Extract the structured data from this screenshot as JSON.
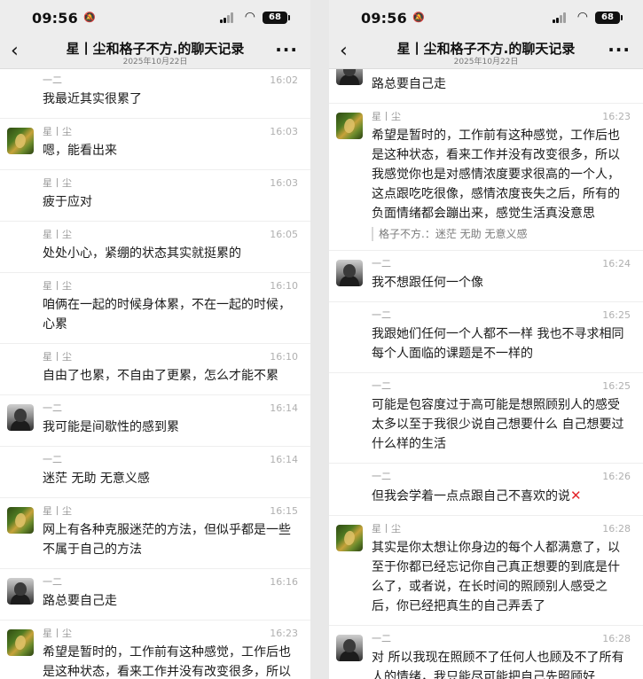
{
  "status": {
    "time": "09:56",
    "battery": "68"
  },
  "nav": {
    "back": "‹",
    "title": "星丨尘和格子不方.的聊天记录",
    "date": "2025年10月22日",
    "more": "···"
  },
  "left": {
    "messages": [
      {
        "sender": "一二",
        "time": "16:02",
        "text": "我最近其实很累了",
        "avatar": "one",
        "showAvatar": false
      },
      {
        "sender": "星丨尘",
        "time": "16:03",
        "text": "嗯，能看出来",
        "avatar": "star",
        "showAvatar": true
      },
      {
        "sender": "星丨尘",
        "time": "16:03",
        "text": "疲于应对",
        "avatar": "star",
        "showAvatar": false
      },
      {
        "sender": "星丨尘",
        "time": "16:05",
        "text": "处处小心，紧绷的状态其实就挺累的",
        "avatar": "star",
        "showAvatar": false
      },
      {
        "sender": "星丨尘",
        "time": "16:10",
        "text": "咱俩在一起的时候身体累，不在一起的时候，心累",
        "avatar": "star",
        "showAvatar": false
      },
      {
        "sender": "星丨尘",
        "time": "16:10",
        "text": "自由了也累，不自由了更累，怎么才能不累",
        "avatar": "star",
        "showAvatar": false
      },
      {
        "sender": "一二",
        "time": "16:14",
        "text": "我可能是间歇性的感到累",
        "avatar": "one",
        "showAvatar": true
      },
      {
        "sender": "一二",
        "time": "16:14",
        "text": "迷茫 无助 无意义感",
        "avatar": "one",
        "showAvatar": false
      },
      {
        "sender": "星丨尘",
        "time": "16:15",
        "text": "网上有各种克服迷茫的方法，但似乎都是一些不属于自己的方法",
        "avatar": "star",
        "showAvatar": true
      },
      {
        "sender": "一二",
        "time": "16:16",
        "text": "路总要自己走",
        "avatar": "one",
        "showAvatar": true
      },
      {
        "sender": "星丨尘",
        "time": "16:23",
        "text": "希望是暂时的，工作前有这种感觉，工作后也是这种状态，看来工作并没有改变很多，所以我感觉你也是对感情浓度要求很高的一个人",
        "avatar": "star",
        "showAvatar": true
      }
    ]
  },
  "right": {
    "messages": [
      {
        "sender": "",
        "time": "",
        "text": "路总要自己走",
        "avatar": "one",
        "showAvatar": true
      },
      {
        "sender": "星丨尘",
        "time": "16:23",
        "text": "希望是暂时的，工作前有这种感觉，工作后也是这种状态，看来工作并没有改变很多，所以我感觉你也是对感情浓度要求很高的一个人，这点跟吃吃很像，感情浓度丧失之后，所有的负面情绪都会蹦出来，感觉生活真没意思",
        "quote": "格子不方.：迷茫 无助 无意义感",
        "avatar": "star",
        "showAvatar": true
      },
      {
        "sender": "一二",
        "time": "16:24",
        "text": "我不想跟任何一个像",
        "avatar": "one",
        "showAvatar": true
      },
      {
        "sender": "一二",
        "time": "16:25",
        "text": "我跟她们任何一个人都不一样 我也不寻求相同 每个人面临的课题是不一样的",
        "avatar": "one",
        "showAvatar": false
      },
      {
        "sender": "一二",
        "time": "16:25",
        "text": "可能是包容度过于高可能是想照顾别人的感受太多以至于我很少说自己想要什么 自己想要过什么样的生活",
        "avatar": "one",
        "showAvatar": false
      },
      {
        "sender": "一二",
        "time": "16:26",
        "text": "但我会学着一点点跟自己不喜欢的说",
        "cross": "✕",
        "avatar": "one",
        "showAvatar": false
      },
      {
        "sender": "星丨尘",
        "time": "16:28",
        "text": "其实是你太想让你身边的每个人都满意了，以至于你都已经忘记你自己真正想要的到底是什么了，或者说，在长时间的照顾别人感受之后，你已经把真生的自己弄丢了",
        "avatar": "star",
        "showAvatar": true
      },
      {
        "sender": "一二",
        "time": "16:28",
        "text": "对 所以我现在照顾不了任何人也顾及不了所有人的情绪，我只能尽可能把自己先照顾好",
        "avatar": "one",
        "showAvatar": true
      }
    ]
  }
}
